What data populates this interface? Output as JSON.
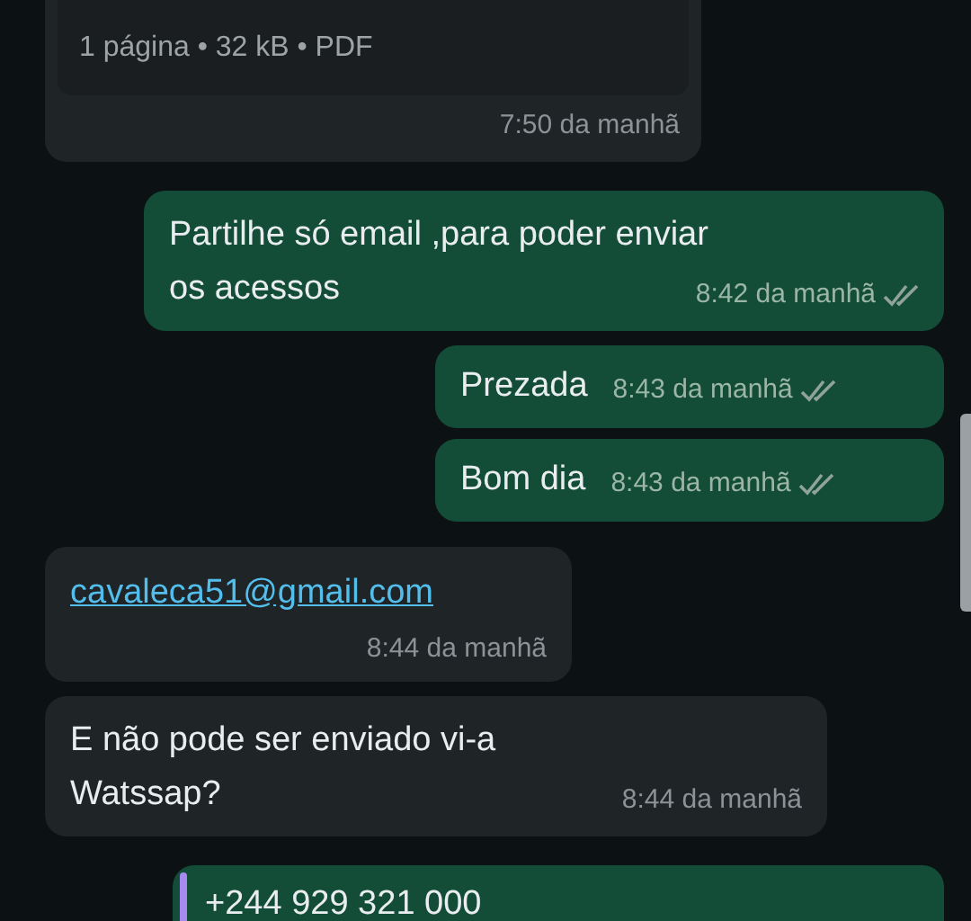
{
  "messages": [
    {
      "kind": "document",
      "outgoing": false,
      "meta": "1 página • 32 kB • PDF",
      "time": "7:50 da manhã"
    },
    {
      "kind": "text",
      "outgoing": true,
      "lines": [
        "Partilhe só email ,para poder enviar",
        "os acessos"
      ],
      "time": "8:42 da manhã",
      "read": false
    },
    {
      "kind": "text",
      "outgoing": true,
      "lines": [
        "Prezada"
      ],
      "time": "8:43 da manhã",
      "read": false
    },
    {
      "kind": "text",
      "outgoing": true,
      "lines": [
        "Bom dia"
      ],
      "time": "8:43 da manhã",
      "read": false
    },
    {
      "kind": "link",
      "outgoing": false,
      "link": "cavaleca51@gmail.com",
      "time": "8:44 da manhã"
    },
    {
      "kind": "text",
      "outgoing": false,
      "lines": [
        "E não pode ser enviado vi-a",
        "Watssap?"
      ],
      "time": "8:44 da manhã"
    },
    {
      "kind": "quote",
      "outgoing": true,
      "quote": "+244 929 321 000"
    }
  ]
}
